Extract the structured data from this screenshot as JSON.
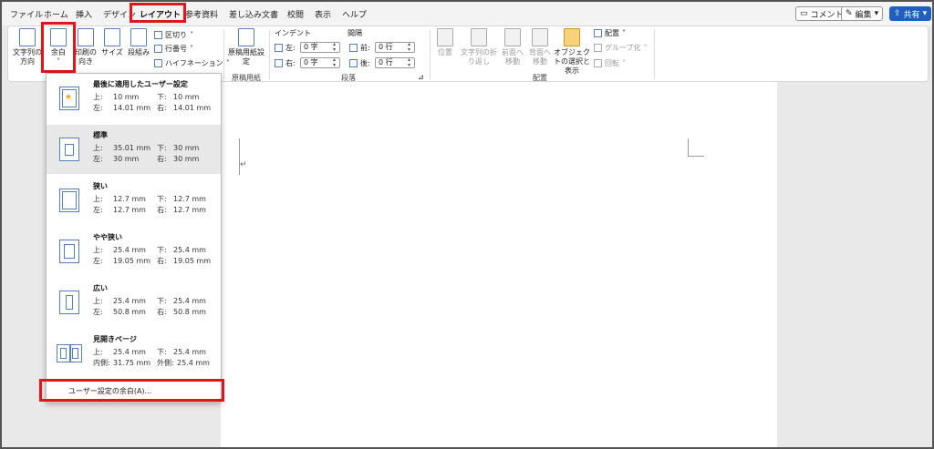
{
  "tabs": [
    {
      "label": "ファイル"
    },
    {
      "label": "ホーム"
    },
    {
      "label": "挿入"
    },
    {
      "label": "デザイン"
    },
    {
      "label": "レイアウト"
    },
    {
      "label": "参考資料"
    },
    {
      "label": "差し込み文書"
    },
    {
      "label": "校閲"
    },
    {
      "label": "表示"
    },
    {
      "label": "ヘルプ"
    }
  ],
  "topright": {
    "comment": "コメント",
    "edit": "編集",
    "share": "共有"
  },
  "ribbon": {
    "text_direction": "文字列の方向",
    "margins": "余白",
    "orientation": "印刷の向き",
    "size": "サイズ",
    "columns": "段組み",
    "breaks": "区切り",
    "line_numbers": "行番号",
    "hyphenation": "ハイフネーション",
    "genkou": "原稿用紙設定",
    "genkou_group": "原稿用紙",
    "indent_label": "インデント",
    "spacing_label": "間隔",
    "left_label": "左:",
    "right_label": "右:",
    "before_label": "前:",
    "after_label": "後:",
    "indent_left": "0 字",
    "indent_right": "0 字",
    "space_before": "0 行",
    "space_after": "0 行",
    "paragraph_group": "段落",
    "position": "位置",
    "wrap_text": "文字列の折り返し",
    "bring_forward": "前面へ移動",
    "send_backward": "背面へ移動",
    "selection_pane": "オブジェクトの選択と表示",
    "align": "配置",
    "group": "グループ化",
    "rotate": "回転",
    "arrange_group": "配置"
  },
  "margins_menu": [
    {
      "title": "最後に適用したユーザー設定",
      "top_l": "上:",
      "top_v": "10 mm",
      "bottom_l": "下:",
      "bottom_v": "10 mm",
      "left_l": "左:",
      "left_v": "14.01 mm",
      "right_l": "右:",
      "right_v": "14.01 mm"
    },
    {
      "title": "標準",
      "top_l": "上:",
      "top_v": "35.01 mm",
      "bottom_l": "下:",
      "bottom_v": "30 mm",
      "left_l": "左:",
      "left_v": "30 mm",
      "right_l": "右:",
      "right_v": "30 mm"
    },
    {
      "title": "狭い",
      "top_l": "上:",
      "top_v": "12.7 mm",
      "bottom_l": "下:",
      "bottom_v": "12.7 mm",
      "left_l": "左:",
      "left_v": "12.7 mm",
      "right_l": "右:",
      "right_v": "12.7 mm"
    },
    {
      "title": "やや狭い",
      "top_l": "上:",
      "top_v": "25.4 mm",
      "bottom_l": "下:",
      "bottom_v": "25.4 mm",
      "left_l": "左:",
      "left_v": "19.05 mm",
      "right_l": "右:",
      "right_v": "19.05 mm"
    },
    {
      "title": "広い",
      "top_l": "上:",
      "top_v": "25.4 mm",
      "bottom_l": "下:",
      "bottom_v": "25.4 mm",
      "left_l": "左:",
      "left_v": "50.8 mm",
      "right_l": "右:",
      "right_v": "50.8 mm"
    },
    {
      "title": "見開きページ",
      "top_l": "上:",
      "top_v": "25.4 mm",
      "bottom_l": "下:",
      "bottom_v": "25.4 mm",
      "left_l": "内側:",
      "left_v": "31.75 mm",
      "right_l": "外側:",
      "right_v": "25.4 mm"
    }
  ],
  "custom_margins": "ユーザー設定の余白(A)...",
  "colors": {
    "accent": "#2b5bb8",
    "highlight": "#e0161a",
    "share": "#1f5fbf"
  }
}
